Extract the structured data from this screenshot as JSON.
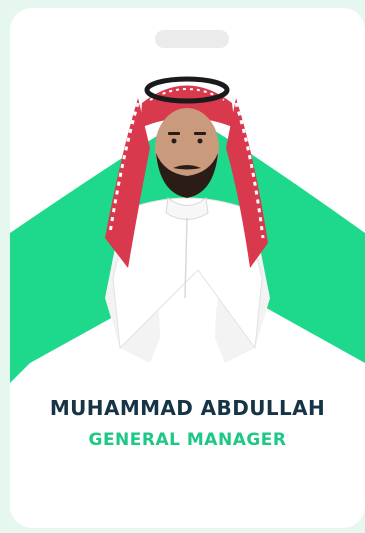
{
  "card": {
    "name": "MUHAMMAD ABDULLAH",
    "title": "GENERAL MANAGER"
  },
  "colors": {
    "background": "#e6f7f0",
    "card": "#ffffff",
    "accent": "#1ed98c",
    "name_text": "#173447",
    "title_text": "#1cc884"
  },
  "photo": {
    "subject": "man in white thobe and red-checked shemagh with black agal"
  }
}
